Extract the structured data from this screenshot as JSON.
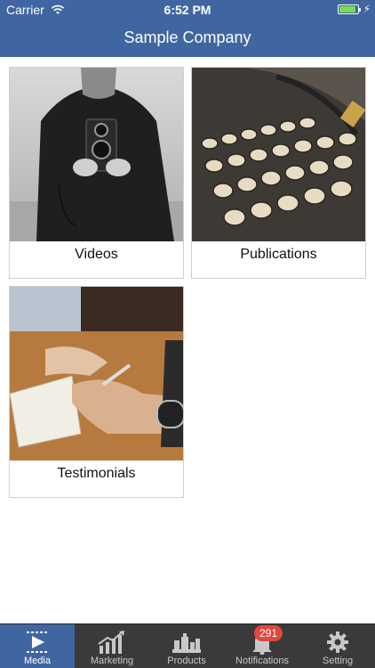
{
  "status_bar": {
    "carrier": "Carrier",
    "time": "6:52 PM",
    "battery_level": 0.9
  },
  "nav": {
    "title": "Sample Company"
  },
  "cards": [
    {
      "label": "Videos",
      "image": "camera-photo"
    },
    {
      "label": "Publications",
      "image": "typewriter-photo"
    },
    {
      "label": "Testimonials",
      "image": "writing-notebook-photo"
    }
  ],
  "tabbar": {
    "tabs": [
      {
        "label": "Media",
        "icon": "play-icon",
        "active": true
      },
      {
        "label": "Marketing",
        "icon": "chart-icon",
        "active": false
      },
      {
        "label": "Products",
        "icon": "products-icon",
        "active": false
      },
      {
        "label": "Notifications",
        "icon": "bell-icon",
        "active": false,
        "badge": "291"
      },
      {
        "label": "Setting",
        "icon": "gear-icon",
        "active": false
      }
    ]
  },
  "colors": {
    "primary": "#3f66a0",
    "tabbar_bg": "#3a3a3a",
    "badge": "#e0473f"
  }
}
